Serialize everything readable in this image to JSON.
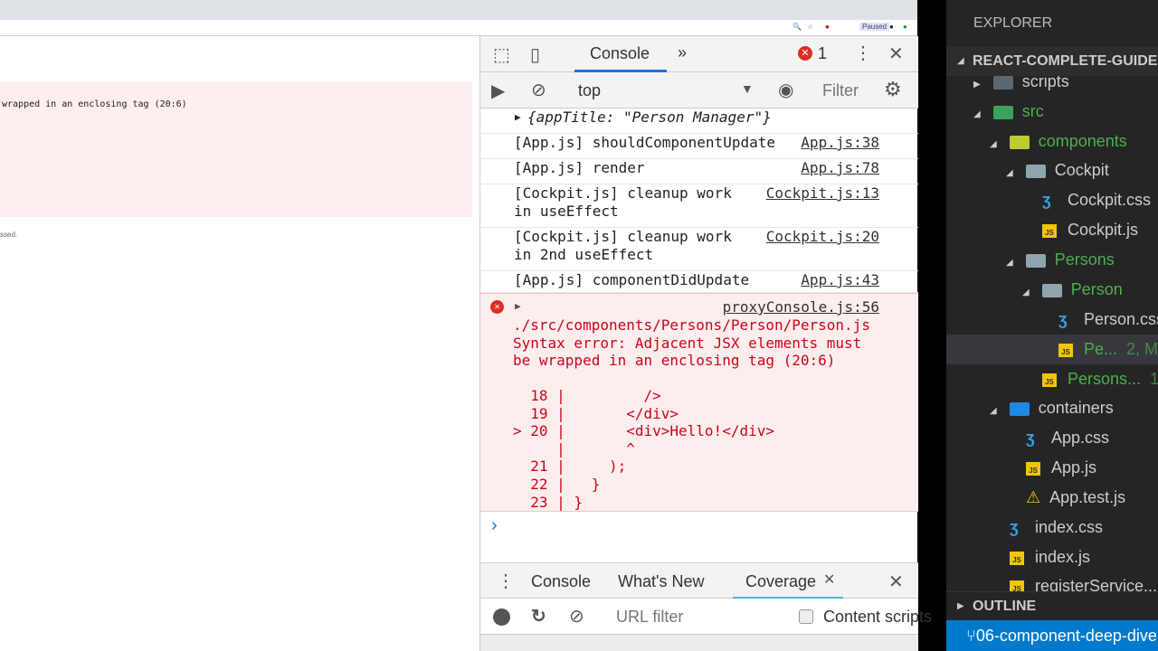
{
  "browser": {
    "paused_label": "Paused",
    "error_text": "wrapped in an enclosing tag (20:6)",
    "footer_text": "ssed."
  },
  "devtools": {
    "tabs": {
      "console": "Console",
      "more": "»",
      "error_count": "1"
    },
    "toolbar": {
      "context": "top",
      "filter_placeholder": "Filter"
    },
    "object_log": "{appTitle: \"Person Manager\"}",
    "logs": [
      {
        "text": "[App.js] shouldComponentUpdate",
        "src": "App.js:38"
      },
      {
        "text": "[App.js] render",
        "src": "App.js:78"
      },
      {
        "text": "[Cockpit.js] cleanup work\nin useEffect",
        "src": "Cockpit.js:13"
      },
      {
        "text": "[Cockpit.js] cleanup work\nin 2nd useEffect",
        "src": "Cockpit.js:20"
      },
      {
        "text": "[App.js] componentDidUpdate",
        "src": "App.js:43"
      }
    ],
    "error": {
      "src": "proxyConsole.js:56",
      "message": "./src/components/Persons/Person/Person.js\nSyntax error: Adjacent JSX elements must\nbe wrapped in an enclosing tag (20:6)",
      "code": "  18 |         />\n  19 |       </div>\n> 20 |       <div>Hello!</div>\n     |       ^\n  21 |     );\n  22 |   }\n  23 | }"
    },
    "prompt": "›",
    "drawer": {
      "tabs": [
        "Console",
        "What's New",
        "Coverage"
      ],
      "url_placeholder": "URL filter",
      "content_scripts": "Content scripts"
    }
  },
  "explorer": {
    "title": "EXPLORER",
    "project": "REACT-COMPLETE-GUIDE",
    "items": [
      {
        "label": "scripts",
        "type": "folder"
      },
      {
        "label": "src",
        "type": "folder"
      },
      {
        "label": "components",
        "type": "folder"
      },
      {
        "label": "Cockpit",
        "type": "folder"
      },
      {
        "label": "Cockpit.css",
        "type": "css"
      },
      {
        "label": "Cockpit.js",
        "type": "js"
      },
      {
        "label": "Persons",
        "type": "folder"
      },
      {
        "label": "Person",
        "type": "folder"
      },
      {
        "label": "Person.css",
        "type": "css"
      },
      {
        "label": "Pe...",
        "type": "js",
        "badge": "2, M"
      },
      {
        "label": "Persons...",
        "type": "js",
        "badge": "1"
      },
      {
        "label": "containers",
        "type": "folder"
      },
      {
        "label": "App.css",
        "type": "css"
      },
      {
        "label": "App.js",
        "type": "js"
      },
      {
        "label": "App.test.js",
        "type": "test"
      },
      {
        "label": "index.css",
        "type": "css"
      },
      {
        "label": "index.js",
        "type": "js"
      },
      {
        "label": "registerService...",
        "type": "js"
      }
    ],
    "outline": "OUTLINE",
    "branch": "06-component-deep-dive"
  },
  "colors": {
    "error": "#d0021b",
    "accent": "#1a73e8",
    "vs_bg": "#252526",
    "status_bar": "#007acc"
  }
}
